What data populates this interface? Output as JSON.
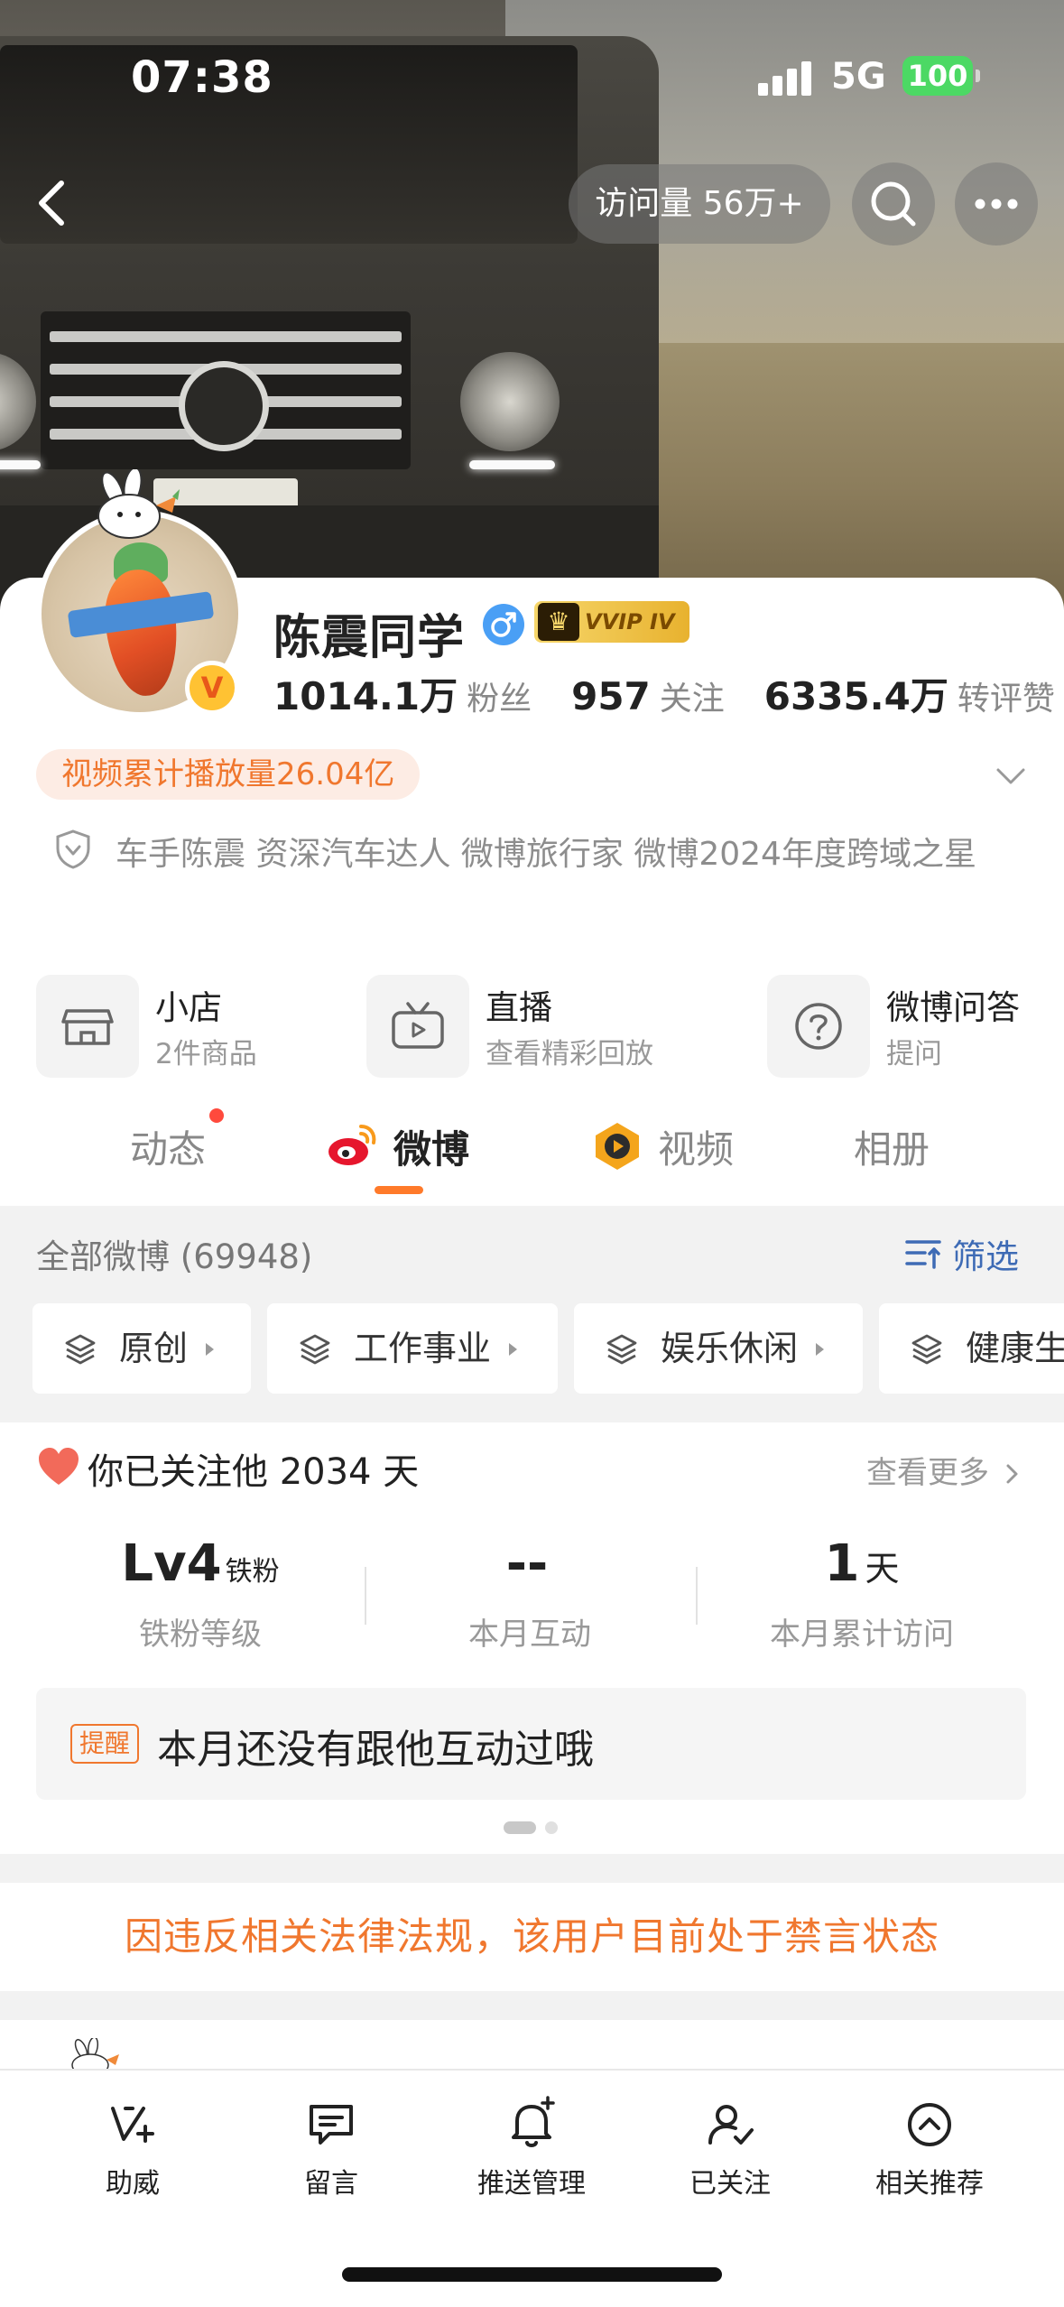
{
  "status_bar": {
    "time": "07:38",
    "network": "5G",
    "battery": "100"
  },
  "header": {
    "visits": "访问量 56万+"
  },
  "profile": {
    "name": "陈震同学",
    "vip_label": "VVIP IV",
    "avatar_badge": "V",
    "stats": [
      {
        "value": "1014.1万",
        "label": "粉丝"
      },
      {
        "value": "957",
        "label": "关注"
      },
      {
        "value": "6335.4万",
        "label": "转评赞"
      }
    ],
    "play_count": "视频累计播放量26.04亿",
    "verification": "车手陈震 资深汽车达人  微博旅行家 微博2024年度跨域之星"
  },
  "services": [
    {
      "title": "小店",
      "subtitle": "2件商品",
      "icon": "shop-icon"
    },
    {
      "title": "直播",
      "subtitle": "查看精彩回放",
      "icon": "live-tv-icon"
    },
    {
      "title": "微博问答",
      "subtitle": "提问",
      "icon": "question-icon"
    }
  ],
  "tabs": [
    {
      "label": "动态",
      "active": false
    },
    {
      "label": "微博",
      "active": true
    },
    {
      "label": "视频",
      "active": false
    },
    {
      "label": "相册",
      "active": false
    }
  ],
  "feed": {
    "all_count": "全部微博 (69948)",
    "filter_label": "筛选",
    "chips": [
      "原创",
      "工作事业",
      "娱乐休闲",
      "健康生"
    ]
  },
  "fan_card": {
    "follow_text": "你已关注他 2034 天",
    "see_more": "查看更多",
    "metrics": [
      {
        "value": "Lv4",
        "suffix": "铁粉",
        "label": "铁粉等级"
      },
      {
        "value": "--",
        "suffix": "",
        "label": "本月互动"
      },
      {
        "value": "1",
        "suffix": "天",
        "label": "本月累计访问"
      }
    ],
    "remind_tag": "提醒",
    "remind_text": "本月还没有跟他互动过哦"
  },
  "ban_notice": "因违反相关法律法规，该用户目前处于禁言状态",
  "bottom_bar": [
    {
      "label": "助威",
      "icon": "cheer-icon"
    },
    {
      "label": "留言",
      "icon": "message-icon"
    },
    {
      "label": "推送管理",
      "icon": "bell-icon"
    },
    {
      "label": "已关注",
      "icon": "followed-user-icon"
    },
    {
      "label": "相关推荐",
      "icon": "recommend-icon"
    }
  ],
  "colors": {
    "accent": "#f0772e",
    "link": "#3e6bb5",
    "tab_indicator": "#ff7a2a",
    "battery": "#4cd964"
  }
}
